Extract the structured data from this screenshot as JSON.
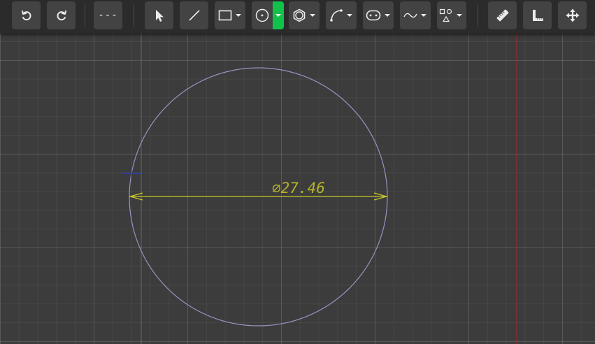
{
  "toolbar": {
    "buttons": [
      {
        "name": "undo",
        "icon": "undo-icon"
      },
      {
        "name": "redo",
        "icon": "redo-icon"
      },
      {
        "name": "line-style",
        "icon": "dashed-line-icon",
        "label": "---"
      },
      {
        "name": "select",
        "icon": "pointer-arrow-icon"
      },
      {
        "name": "line",
        "icon": "line-icon"
      },
      {
        "name": "rectangle",
        "icon": "rectangle-icon",
        "dropdown": true
      },
      {
        "name": "circle",
        "icon": "circle-icon",
        "dropdown": true,
        "active": true
      },
      {
        "name": "polygon",
        "icon": "hexagon-icon",
        "dropdown": true
      },
      {
        "name": "arc",
        "icon": "arc-icon",
        "dropdown": true
      },
      {
        "name": "slot",
        "icon": "slot-icon",
        "dropdown": true
      },
      {
        "name": "spline",
        "icon": "spline-icon",
        "dropdown": true
      },
      {
        "name": "shapes",
        "icon": "shapes-icon",
        "dropdown": true
      },
      {
        "name": "measure",
        "icon": "ruler-icon"
      },
      {
        "name": "constraint",
        "icon": "set-square-icon"
      },
      {
        "name": "move",
        "icon": "move-arrows-icon"
      }
    ],
    "active_color": "#11c24a"
  },
  "canvas": {
    "dimension_label": "⌀27.46",
    "circle_color": "#9a93c2",
    "dimension_color": "#c8c82a",
    "axis_color": "#b2252a",
    "cursor_color": "#2e3ccf"
  }
}
